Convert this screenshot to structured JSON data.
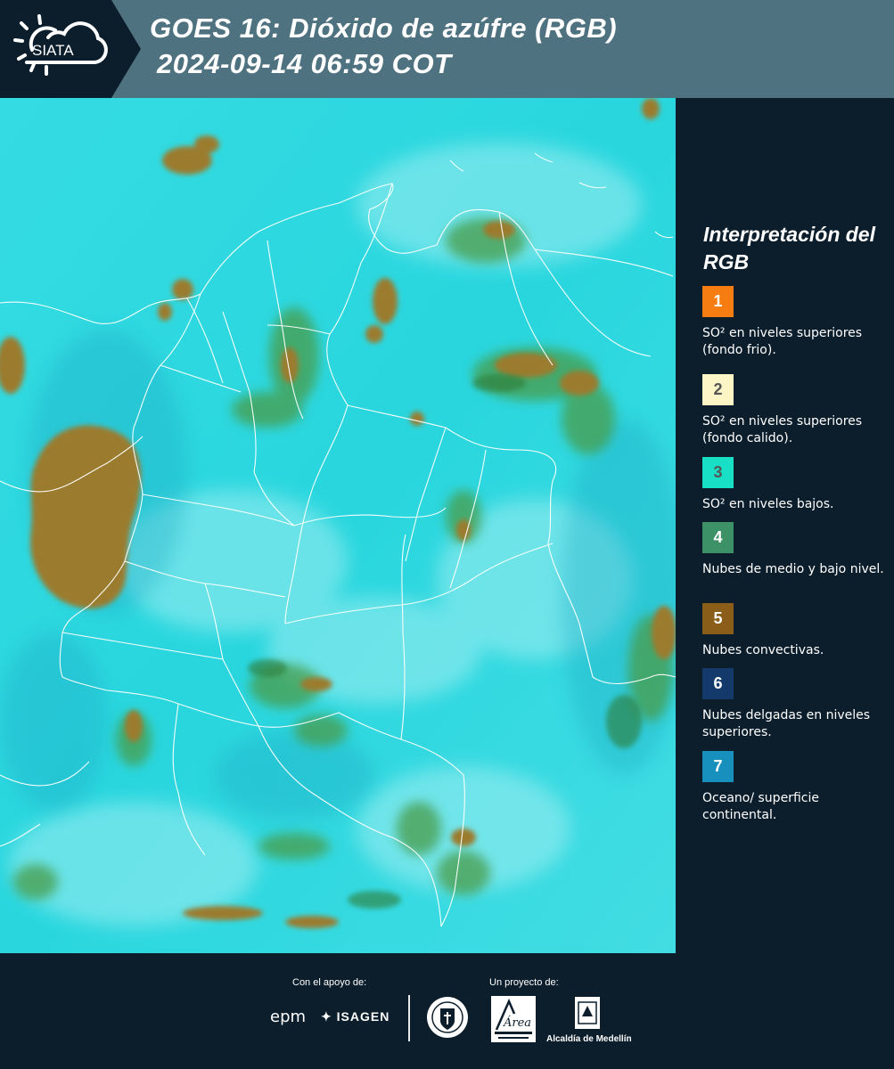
{
  "header": {
    "logo_text": "SIATA",
    "title_line1": "GOES 16: Dióxido de azúfre (RGB)",
    "title_line2": "2024-09-14 06:59 COT"
  },
  "legend": {
    "title": "Interpretación del RGB",
    "items": [
      {
        "number": "1",
        "text": "SO² en niveles superiores (fondo frio).",
        "color": "#f57d12",
        "number_color": "#ffffff"
      },
      {
        "number": "2",
        "text": "SO² en niveles superiores (fondo calido).",
        "color": "#fcf5c6",
        "number_color": "#555555"
      },
      {
        "number": "3",
        "text": "SO² en niveles bajos.",
        "color": "#18e0c7",
        "number_color": "#555555"
      },
      {
        "number": "4",
        "text": "Nubes de medio y bajo nivel.",
        "color": "#3d9166",
        "number_color": "#ffffff"
      },
      {
        "number": "5",
        "text": "Nubes convectivas.",
        "color": "#8a5d19",
        "number_color": "#ffffff"
      },
      {
        "number": "6",
        "text": "Nubes delgadas en niveles superiores.",
        "color": "#143a6b",
        "number_color": "#ffffff"
      },
      {
        "number": "7",
        "text": "Oceano/ superficie continental.",
        "color": "#1790be",
        "number_color": "#ffffff"
      }
    ]
  },
  "footer": {
    "support_label": "Con el apoyo de:",
    "project_label": "Un proyecto de:",
    "sponsor_1": "epm",
    "sponsor_2": "ISAGEN",
    "partner_area_text": "Área",
    "partner_alcaldia": "Alcaldía de Medellín"
  },
  "colors": {
    "background": "#0c1e2c",
    "header_bar": "#4f7281",
    "ocean_cyan": "#2ad8df",
    "cloud_green": "#3f9a4d",
    "convective_brown": "#9e7a2d"
  }
}
